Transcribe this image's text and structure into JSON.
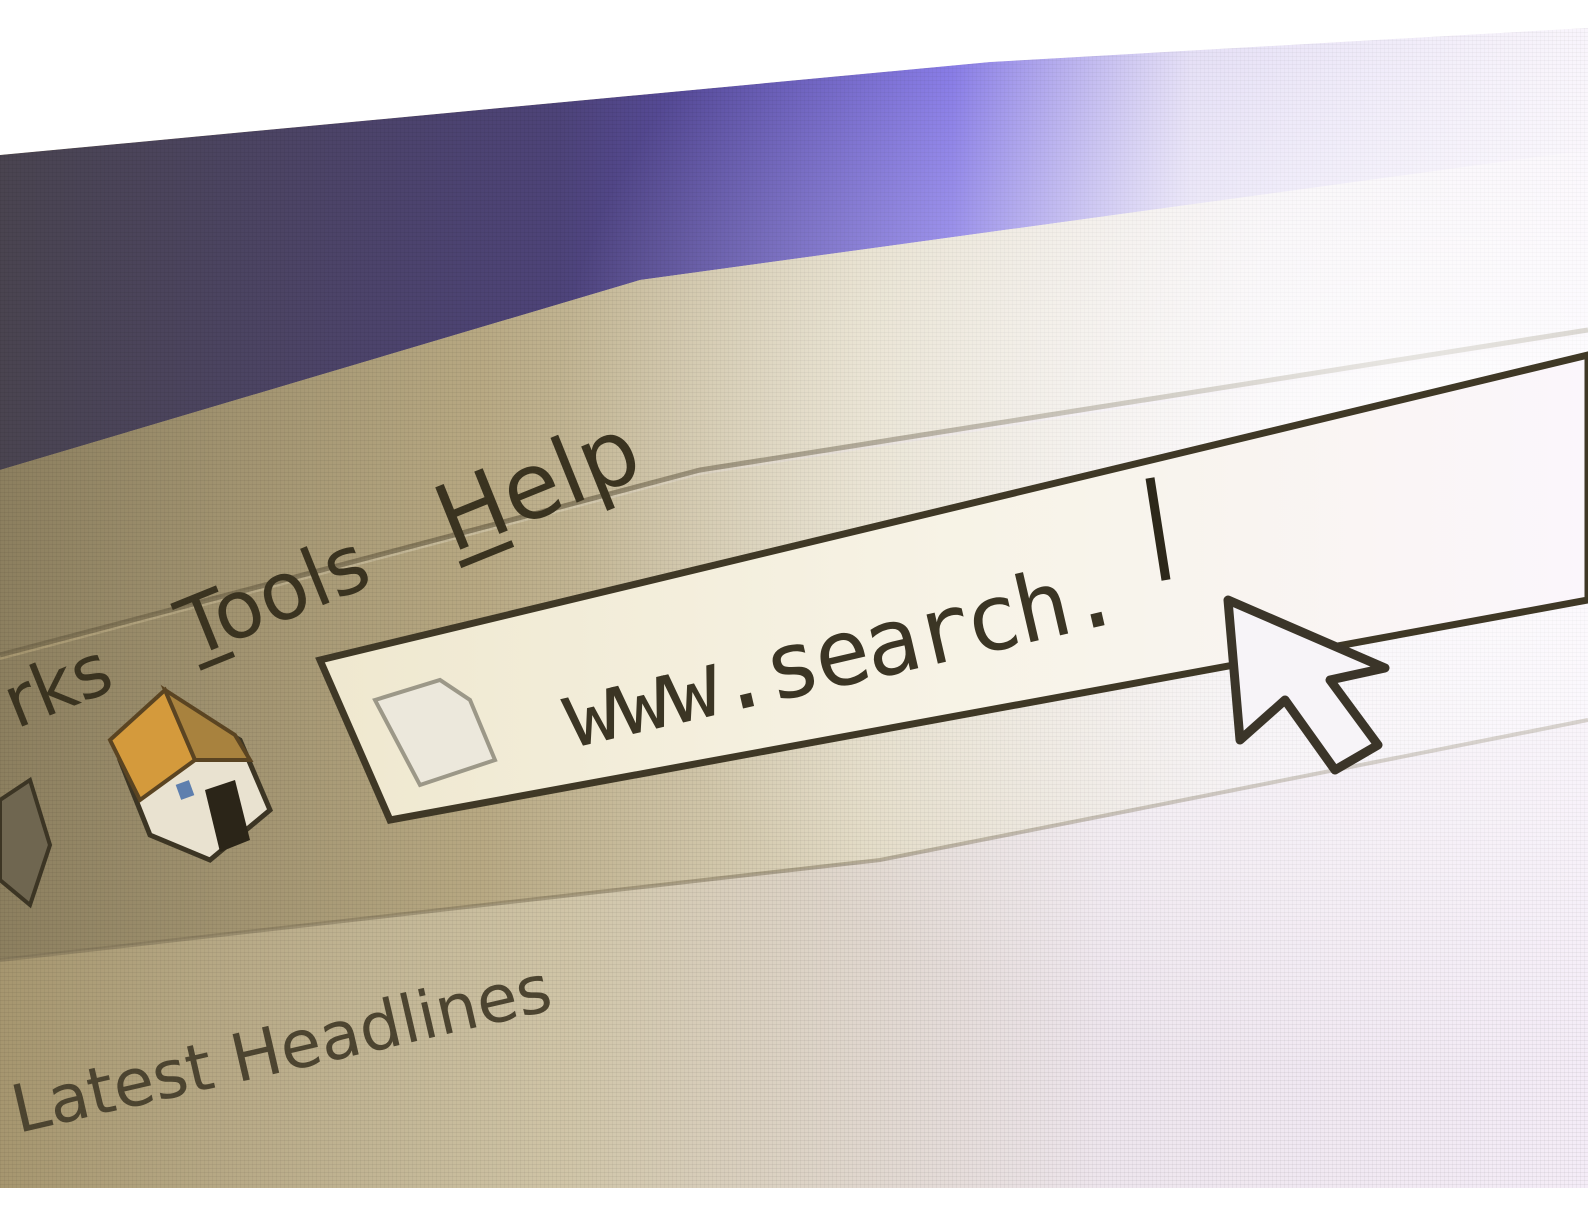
{
  "menu": {
    "items": [
      {
        "label": "rks",
        "mnemonic": ""
      },
      {
        "label": "Tools",
        "mnemonic": "T"
      },
      {
        "label": "Help",
        "mnemonic": "H"
      }
    ]
  },
  "address_bar": {
    "value": "www.search."
  },
  "links_bar": {
    "label": "Latest Headlines"
  },
  "icons": {
    "home": "home-icon",
    "page": "page-icon",
    "cursor": "mouse-pointer-icon"
  },
  "colors": {
    "toolbar": "#b9ab86",
    "title_bar": "#4b3f78",
    "accent_blue": "#6a5ce0",
    "address_field": "#f4f0df",
    "text": "#3a3320"
  }
}
